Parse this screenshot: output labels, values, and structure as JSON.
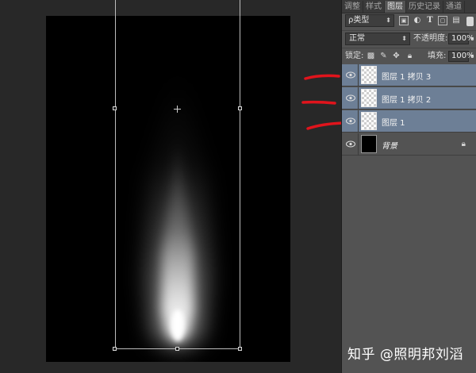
{
  "panel": {
    "tabs": [
      {
        "label": "调整",
        "active": false
      },
      {
        "label": "样式",
        "active": false
      },
      {
        "label": "图层",
        "active": true
      },
      {
        "label": "历史记录",
        "active": false
      },
      {
        "label": "通道",
        "active": false
      }
    ],
    "filter": {
      "select_label": "ρ类型",
      "icons": [
        "image-filter-icon",
        "adjustment-filter-icon",
        "text-filter-icon",
        "shape-filter-icon",
        "smart-object-filter-icon"
      ]
    },
    "blend": {
      "mode": "正常",
      "opacity_label": "不透明度:",
      "opacity_value": "100%"
    },
    "lock": {
      "label": "锁定:",
      "fill_label": "填充:",
      "fill_value": "100%"
    },
    "layers": [
      {
        "name": "图层 1 拷贝 3",
        "selected": true,
        "visible": true,
        "thumbnail": "transparent"
      },
      {
        "name": "图层 1 拷贝 2",
        "selected": true,
        "visible": true,
        "thumbnail": "transparent"
      },
      {
        "name": "图层 1",
        "selected": true,
        "visible": true,
        "thumbnail": "transparent"
      },
      {
        "name": "背景",
        "selected": false,
        "visible": true,
        "thumbnail": "black",
        "locked": true
      }
    ]
  },
  "watermark": "知乎 @照明邦刘滔",
  "colors": {
    "selection": "#6d7f96",
    "annotation": "#e0141c",
    "canvas": "#000000"
  }
}
